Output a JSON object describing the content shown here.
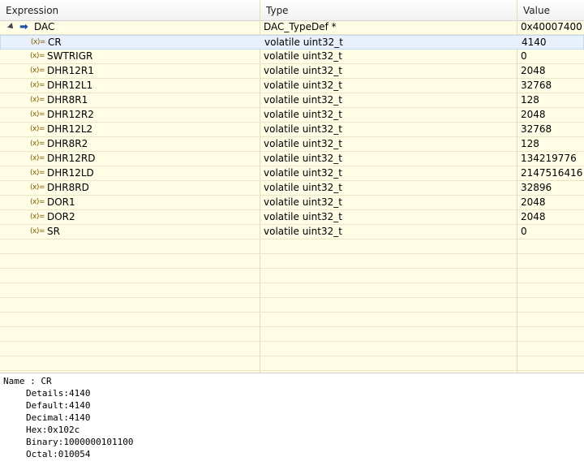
{
  "columns": {
    "expression": "Expression",
    "type": "Type",
    "value": "Value"
  },
  "root": {
    "name": "DAC",
    "type": "DAC_TypeDef *",
    "value": "0x40007400"
  },
  "rows": [
    {
      "name": "CR",
      "type": "volatile uint32_t",
      "value": "4140",
      "selected": true
    },
    {
      "name": "SWTRIGR",
      "type": "volatile uint32_t",
      "value": "0"
    },
    {
      "name": "DHR12R1",
      "type": "volatile uint32_t",
      "value": "2048"
    },
    {
      "name": "DHR12L1",
      "type": "volatile uint32_t",
      "value": "32768"
    },
    {
      "name": "DHR8R1",
      "type": "volatile uint32_t",
      "value": "128"
    },
    {
      "name": "DHR12R2",
      "type": "volatile uint32_t",
      "value": "2048"
    },
    {
      "name": "DHR12L2",
      "type": "volatile uint32_t",
      "value": "32768"
    },
    {
      "name": "DHR8R2",
      "type": "volatile uint32_t",
      "value": "128"
    },
    {
      "name": "DHR12RD",
      "type": "volatile uint32_t",
      "value": "134219776"
    },
    {
      "name": "DHR12LD",
      "type": "volatile uint32_t",
      "value": "2147516416"
    },
    {
      "name": "DHR8RD",
      "type": "volatile uint32_t",
      "value": "32896"
    },
    {
      "name": "DOR1",
      "type": "volatile uint32_t",
      "value": "2048"
    },
    {
      "name": "DOR2",
      "type": "volatile uint32_t",
      "value": "2048"
    },
    {
      "name": "SR",
      "type": "volatile uint32_t",
      "value": "0"
    }
  ],
  "var_icon": "(x)=",
  "details": {
    "name_line": "Name : CR",
    "lines": [
      "Details:4140",
      "Default:4140",
      "Decimal:4140",
      "Hex:0x102c",
      "Binary:1000000101100",
      "Octal:010054"
    ]
  }
}
